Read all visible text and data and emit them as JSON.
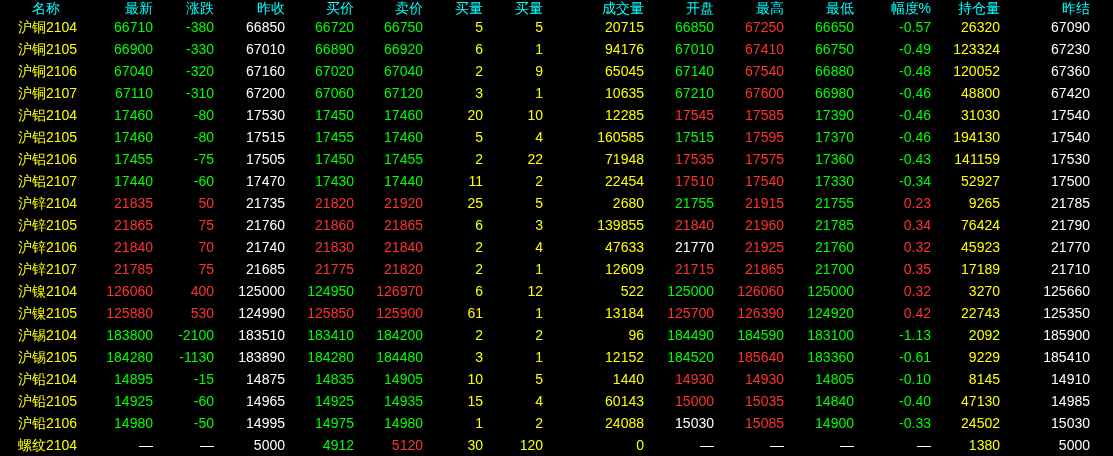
{
  "columns": [
    "名称",
    "最新",
    "涨跌",
    "昨收",
    "买价",
    "卖价",
    "买量",
    "买量",
    "成交量",
    "开盘",
    "最高",
    "最低",
    "幅度%",
    "持仓量",
    "昨结"
  ],
  "rows": [
    {
      "cells": [
        {
          "text": "沪铜2104",
          "color": "#ffff00"
        },
        {
          "text": "66710",
          "color": "#00ff00"
        },
        {
          "text": "-380",
          "color": "#00ff00"
        },
        {
          "text": "66850",
          "color": "#ffffff"
        },
        {
          "text": "66720",
          "color": "#00ff00"
        },
        {
          "text": "66750",
          "color": "#00ff00"
        },
        {
          "text": "5",
          "color": "#ffff00"
        },
        {
          "text": "5",
          "color": "#ffff00"
        },
        {
          "text": "20715",
          "color": "#ffff00"
        },
        {
          "text": "66850",
          "color": "#00ff00"
        },
        {
          "text": "67250",
          "color": "#ff3232"
        },
        {
          "text": "66650",
          "color": "#00ff00"
        },
        {
          "text": "-0.57",
          "color": "#00ff00"
        },
        {
          "text": "26320",
          "color": "#ffff00"
        },
        {
          "text": "67090",
          "color": "#ffffff"
        }
      ]
    },
    {
      "cells": [
        {
          "text": "沪铜2105",
          "color": "#ffff00"
        },
        {
          "text": "66900",
          "color": "#00ff00"
        },
        {
          "text": "-330",
          "color": "#00ff00"
        },
        {
          "text": "67010",
          "color": "#ffffff"
        },
        {
          "text": "66890",
          "color": "#00ff00"
        },
        {
          "text": "66920",
          "color": "#00ff00"
        },
        {
          "text": "6",
          "color": "#ffff00"
        },
        {
          "text": "1",
          "color": "#ffff00"
        },
        {
          "text": "94176",
          "color": "#ffff00"
        },
        {
          "text": "67010",
          "color": "#00ff00"
        },
        {
          "text": "67410",
          "color": "#ff3232"
        },
        {
          "text": "66750",
          "color": "#00ff00"
        },
        {
          "text": "-0.49",
          "color": "#00ff00"
        },
        {
          "text": "123324",
          "color": "#ffff00"
        },
        {
          "text": "67230",
          "color": "#ffffff"
        }
      ]
    },
    {
      "cells": [
        {
          "text": "沪铜2106",
          "color": "#ffff00"
        },
        {
          "text": "67040",
          "color": "#00ff00"
        },
        {
          "text": "-320",
          "color": "#00ff00"
        },
        {
          "text": "67160",
          "color": "#ffffff"
        },
        {
          "text": "67020",
          "color": "#00ff00"
        },
        {
          "text": "67040",
          "color": "#00ff00"
        },
        {
          "text": "2",
          "color": "#ffff00"
        },
        {
          "text": "9",
          "color": "#ffff00"
        },
        {
          "text": "65045",
          "color": "#ffff00"
        },
        {
          "text": "67140",
          "color": "#00ff00"
        },
        {
          "text": "67540",
          "color": "#ff3232"
        },
        {
          "text": "66880",
          "color": "#00ff00"
        },
        {
          "text": "-0.48",
          "color": "#00ff00"
        },
        {
          "text": "120052",
          "color": "#ffff00"
        },
        {
          "text": "67360",
          "color": "#ffffff"
        }
      ]
    },
    {
      "cells": [
        {
          "text": "沪铜2107",
          "color": "#ffff00"
        },
        {
          "text": "67110",
          "color": "#00ff00"
        },
        {
          "text": "-310",
          "color": "#00ff00"
        },
        {
          "text": "67200",
          "color": "#ffffff"
        },
        {
          "text": "67060",
          "color": "#00ff00"
        },
        {
          "text": "67120",
          "color": "#00ff00"
        },
        {
          "text": "3",
          "color": "#ffff00"
        },
        {
          "text": "1",
          "color": "#ffff00"
        },
        {
          "text": "10635",
          "color": "#ffff00"
        },
        {
          "text": "67210",
          "color": "#00ff00"
        },
        {
          "text": "67600",
          "color": "#ff3232"
        },
        {
          "text": "66980",
          "color": "#00ff00"
        },
        {
          "text": "-0.46",
          "color": "#00ff00"
        },
        {
          "text": "48800",
          "color": "#ffff00"
        },
        {
          "text": "67420",
          "color": "#ffffff"
        }
      ]
    },
    {
      "cells": [
        {
          "text": "沪铝2104",
          "color": "#ffff00"
        },
        {
          "text": "17460",
          "color": "#00ff00"
        },
        {
          "text": "-80",
          "color": "#00ff00"
        },
        {
          "text": "17530",
          "color": "#ffffff"
        },
        {
          "text": "17450",
          "color": "#00ff00"
        },
        {
          "text": "17460",
          "color": "#00ff00"
        },
        {
          "text": "20",
          "color": "#ffff00"
        },
        {
          "text": "10",
          "color": "#ffff00"
        },
        {
          "text": "12285",
          "color": "#ffff00"
        },
        {
          "text": "17545",
          "color": "#ff3232"
        },
        {
          "text": "17585",
          "color": "#ff3232"
        },
        {
          "text": "17390",
          "color": "#00ff00"
        },
        {
          "text": "-0.46",
          "color": "#00ff00"
        },
        {
          "text": "31030",
          "color": "#ffff00"
        },
        {
          "text": "17540",
          "color": "#ffffff"
        }
      ]
    },
    {
      "cells": [
        {
          "text": "沪铝2105",
          "color": "#ffff00"
        },
        {
          "text": "17460",
          "color": "#00ff00"
        },
        {
          "text": "-80",
          "color": "#00ff00"
        },
        {
          "text": "17515",
          "color": "#ffffff"
        },
        {
          "text": "17455",
          "color": "#00ff00"
        },
        {
          "text": "17460",
          "color": "#00ff00"
        },
        {
          "text": "5",
          "color": "#ffff00"
        },
        {
          "text": "4",
          "color": "#ffff00"
        },
        {
          "text": "160585",
          "color": "#ffff00"
        },
        {
          "text": "17515",
          "color": "#00ff00"
        },
        {
          "text": "17595",
          "color": "#ff3232"
        },
        {
          "text": "17370",
          "color": "#00ff00"
        },
        {
          "text": "-0.46",
          "color": "#00ff00"
        },
        {
          "text": "194130",
          "color": "#ffff00"
        },
        {
          "text": "17540",
          "color": "#ffffff"
        }
      ]
    },
    {
      "cells": [
        {
          "text": "沪铝2106",
          "color": "#ffff00"
        },
        {
          "text": "17455",
          "color": "#00ff00"
        },
        {
          "text": "-75",
          "color": "#00ff00"
        },
        {
          "text": "17505",
          "color": "#ffffff"
        },
        {
          "text": "17450",
          "color": "#00ff00"
        },
        {
          "text": "17455",
          "color": "#00ff00"
        },
        {
          "text": "2",
          "color": "#ffff00"
        },
        {
          "text": "22",
          "color": "#ffff00"
        },
        {
          "text": "71948",
          "color": "#ffff00"
        },
        {
          "text": "17535",
          "color": "#ff3232"
        },
        {
          "text": "17575",
          "color": "#ff3232"
        },
        {
          "text": "17360",
          "color": "#00ff00"
        },
        {
          "text": "-0.43",
          "color": "#00ff00"
        },
        {
          "text": "141159",
          "color": "#ffff00"
        },
        {
          "text": "17530",
          "color": "#ffffff"
        }
      ]
    },
    {
      "cells": [
        {
          "text": "沪铝2107",
          "color": "#ffff00"
        },
        {
          "text": "17440",
          "color": "#00ff00"
        },
        {
          "text": "-60",
          "color": "#00ff00"
        },
        {
          "text": "17470",
          "color": "#ffffff"
        },
        {
          "text": "17430",
          "color": "#00ff00"
        },
        {
          "text": "17440",
          "color": "#00ff00"
        },
        {
          "text": "11",
          "color": "#ffff00"
        },
        {
          "text": "2",
          "color": "#ffff00"
        },
        {
          "text": "22454",
          "color": "#ffff00"
        },
        {
          "text": "17510",
          "color": "#ff3232"
        },
        {
          "text": "17540",
          "color": "#ff3232"
        },
        {
          "text": "17330",
          "color": "#00ff00"
        },
        {
          "text": "-0.34",
          "color": "#00ff00"
        },
        {
          "text": "52927",
          "color": "#ffff00"
        },
        {
          "text": "17500",
          "color": "#ffffff"
        }
      ]
    },
    {
      "cells": [
        {
          "text": "沪锌2104",
          "color": "#ffff00"
        },
        {
          "text": "21835",
          "color": "#ff3232"
        },
        {
          "text": "50",
          "color": "#ff3232"
        },
        {
          "text": "21735",
          "color": "#ffffff"
        },
        {
          "text": "21820",
          "color": "#ff3232"
        },
        {
          "text": "21920",
          "color": "#ff3232"
        },
        {
          "text": "25",
          "color": "#ffff00"
        },
        {
          "text": "5",
          "color": "#ffff00"
        },
        {
          "text": "2680",
          "color": "#ffff00"
        },
        {
          "text": "21755",
          "color": "#00ff00"
        },
        {
          "text": "21915",
          "color": "#ff3232"
        },
        {
          "text": "21755",
          "color": "#00ff00"
        },
        {
          "text": "0.23",
          "color": "#ff3232"
        },
        {
          "text": "9265",
          "color": "#ffff00"
        },
        {
          "text": "21785",
          "color": "#ffffff"
        }
      ]
    },
    {
      "cells": [
        {
          "text": "沪锌2105",
          "color": "#ffff00"
        },
        {
          "text": "21865",
          "color": "#ff3232"
        },
        {
          "text": "75",
          "color": "#ff3232"
        },
        {
          "text": "21760",
          "color": "#ffffff"
        },
        {
          "text": "21860",
          "color": "#ff3232"
        },
        {
          "text": "21865",
          "color": "#ff3232"
        },
        {
          "text": "6",
          "color": "#ffff00"
        },
        {
          "text": "3",
          "color": "#ffff00"
        },
        {
          "text": "139855",
          "color": "#ffff00"
        },
        {
          "text": "21840",
          "color": "#ff3232"
        },
        {
          "text": "21960",
          "color": "#ff3232"
        },
        {
          "text": "21785",
          "color": "#00ff00"
        },
        {
          "text": "0.34",
          "color": "#ff3232"
        },
        {
          "text": "76424",
          "color": "#ffff00"
        },
        {
          "text": "21790",
          "color": "#ffffff"
        }
      ]
    },
    {
      "cells": [
        {
          "text": "沪锌2106",
          "color": "#ffff00"
        },
        {
          "text": "21840",
          "color": "#ff3232"
        },
        {
          "text": "70",
          "color": "#ff3232"
        },
        {
          "text": "21740",
          "color": "#ffffff"
        },
        {
          "text": "21830",
          "color": "#ff3232"
        },
        {
          "text": "21840",
          "color": "#ff3232"
        },
        {
          "text": "2",
          "color": "#ffff00"
        },
        {
          "text": "4",
          "color": "#ffff00"
        },
        {
          "text": "47633",
          "color": "#ffff00"
        },
        {
          "text": "21770",
          "color": "#ffffff"
        },
        {
          "text": "21925",
          "color": "#ff3232"
        },
        {
          "text": "21760",
          "color": "#00ff00"
        },
        {
          "text": "0.32",
          "color": "#ff3232"
        },
        {
          "text": "45923",
          "color": "#ffff00"
        },
        {
          "text": "21770",
          "color": "#ffffff"
        }
      ]
    },
    {
      "cells": [
        {
          "text": "沪锌2107",
          "color": "#ffff00"
        },
        {
          "text": "21785",
          "color": "#ff3232"
        },
        {
          "text": "75",
          "color": "#ff3232"
        },
        {
          "text": "21685",
          "color": "#ffffff"
        },
        {
          "text": "21775",
          "color": "#ff3232"
        },
        {
          "text": "21820",
          "color": "#ff3232"
        },
        {
          "text": "2",
          "color": "#ffff00"
        },
        {
          "text": "1",
          "color": "#ffff00"
        },
        {
          "text": "12609",
          "color": "#ffff00"
        },
        {
          "text": "21715",
          "color": "#ff3232"
        },
        {
          "text": "21865",
          "color": "#ff3232"
        },
        {
          "text": "21700",
          "color": "#00ff00"
        },
        {
          "text": "0.35",
          "color": "#ff3232"
        },
        {
          "text": "17189",
          "color": "#ffff00"
        },
        {
          "text": "21710",
          "color": "#ffffff"
        }
      ]
    },
    {
      "cells": [
        {
          "text": "沪镍2104",
          "color": "#ffff00"
        },
        {
          "text": "126060",
          "color": "#ff3232"
        },
        {
          "text": "400",
          "color": "#ff3232"
        },
        {
          "text": "125000",
          "color": "#ffffff"
        },
        {
          "text": "124950",
          "color": "#00ff00"
        },
        {
          "text": "126970",
          "color": "#ff3232"
        },
        {
          "text": "6",
          "color": "#ffff00"
        },
        {
          "text": "12",
          "color": "#ffff00"
        },
        {
          "text": "522",
          "color": "#ffff00"
        },
        {
          "text": "125000",
          "color": "#00ff00"
        },
        {
          "text": "126060",
          "color": "#ff3232"
        },
        {
          "text": "125000",
          "color": "#00ff00"
        },
        {
          "text": "0.32",
          "color": "#ff3232"
        },
        {
          "text": "3270",
          "color": "#ffff00"
        },
        {
          "text": "125660",
          "color": "#ffffff"
        }
      ]
    },
    {
      "cells": [
        {
          "text": "沪镍2105",
          "color": "#ffff00"
        },
        {
          "text": "125880",
          "color": "#ff3232"
        },
        {
          "text": "530",
          "color": "#ff3232"
        },
        {
          "text": "124990",
          "color": "#ffffff"
        },
        {
          "text": "125850",
          "color": "#ff3232"
        },
        {
          "text": "125900",
          "color": "#ff3232"
        },
        {
          "text": "61",
          "color": "#ffff00"
        },
        {
          "text": "1",
          "color": "#ffff00"
        },
        {
          "text": "13184",
          "color": "#ffff00"
        },
        {
          "text": "125700",
          "color": "#ff3232"
        },
        {
          "text": "126390",
          "color": "#ff3232"
        },
        {
          "text": "124920",
          "color": "#00ff00"
        },
        {
          "text": "0.42",
          "color": "#ff3232"
        },
        {
          "text": "22743",
          "color": "#ffff00"
        },
        {
          "text": "125350",
          "color": "#ffffff"
        }
      ]
    },
    {
      "cells": [
        {
          "text": "沪锡2104",
          "color": "#ffff00"
        },
        {
          "text": "183800",
          "color": "#00ff00"
        },
        {
          "text": "-2100",
          "color": "#00ff00"
        },
        {
          "text": "183510",
          "color": "#ffffff"
        },
        {
          "text": "183410",
          "color": "#00ff00"
        },
        {
          "text": "184200",
          "color": "#00ff00"
        },
        {
          "text": "2",
          "color": "#ffff00"
        },
        {
          "text": "2",
          "color": "#ffff00"
        },
        {
          "text": "96",
          "color": "#ffff00"
        },
        {
          "text": "184490",
          "color": "#00ff00"
        },
        {
          "text": "184590",
          "color": "#00ff00"
        },
        {
          "text": "183100",
          "color": "#00ff00"
        },
        {
          "text": "-1.13",
          "color": "#00ff00"
        },
        {
          "text": "2092",
          "color": "#ffff00"
        },
        {
          "text": "185900",
          "color": "#ffffff"
        }
      ]
    },
    {
      "cells": [
        {
          "text": "沪锡2105",
          "color": "#ffff00"
        },
        {
          "text": "184280",
          "color": "#00ff00"
        },
        {
          "text": "-1130",
          "color": "#00ff00"
        },
        {
          "text": "183890",
          "color": "#ffffff"
        },
        {
          "text": "184280",
          "color": "#00ff00"
        },
        {
          "text": "184480",
          "color": "#00ff00"
        },
        {
          "text": "3",
          "color": "#ffff00"
        },
        {
          "text": "1",
          "color": "#ffff00"
        },
        {
          "text": "12152",
          "color": "#ffff00"
        },
        {
          "text": "184520",
          "color": "#00ff00"
        },
        {
          "text": "185640",
          "color": "#ff3232"
        },
        {
          "text": "183360",
          "color": "#00ff00"
        },
        {
          "text": "-0.61",
          "color": "#00ff00"
        },
        {
          "text": "9229",
          "color": "#ffff00"
        },
        {
          "text": "185410",
          "color": "#ffffff"
        }
      ]
    },
    {
      "cells": [
        {
          "text": "沪铅2104",
          "color": "#ffff00"
        },
        {
          "text": "14895",
          "color": "#00ff00"
        },
        {
          "text": "-15",
          "color": "#00ff00"
        },
        {
          "text": "14875",
          "color": "#ffffff"
        },
        {
          "text": "14835",
          "color": "#00ff00"
        },
        {
          "text": "14905",
          "color": "#00ff00"
        },
        {
          "text": "10",
          "color": "#ffff00"
        },
        {
          "text": "5",
          "color": "#ffff00"
        },
        {
          "text": "1440",
          "color": "#ffff00"
        },
        {
          "text": "14930",
          "color": "#ff3232"
        },
        {
          "text": "14930",
          "color": "#ff3232"
        },
        {
          "text": "14805",
          "color": "#00ff00"
        },
        {
          "text": "-0.10",
          "color": "#00ff00"
        },
        {
          "text": "8145",
          "color": "#ffff00"
        },
        {
          "text": "14910",
          "color": "#ffffff"
        }
      ]
    },
    {
      "cells": [
        {
          "text": "沪铅2105",
          "color": "#ffff00"
        },
        {
          "text": "14925",
          "color": "#00ff00"
        },
        {
          "text": "-60",
          "color": "#00ff00"
        },
        {
          "text": "14965",
          "color": "#ffffff"
        },
        {
          "text": "14925",
          "color": "#00ff00"
        },
        {
          "text": "14935",
          "color": "#00ff00"
        },
        {
          "text": "15",
          "color": "#ffff00"
        },
        {
          "text": "4",
          "color": "#ffff00"
        },
        {
          "text": "60143",
          "color": "#ffff00"
        },
        {
          "text": "15000",
          "color": "#ff3232"
        },
        {
          "text": "15035",
          "color": "#ff3232"
        },
        {
          "text": "14840",
          "color": "#00ff00"
        },
        {
          "text": "-0.40",
          "color": "#00ff00"
        },
        {
          "text": "47130",
          "color": "#ffff00"
        },
        {
          "text": "14985",
          "color": "#ffffff"
        }
      ]
    },
    {
      "cells": [
        {
          "text": "沪铅2106",
          "color": "#ffff00"
        },
        {
          "text": "14980",
          "color": "#00ff00"
        },
        {
          "text": "-50",
          "color": "#00ff00"
        },
        {
          "text": "14995",
          "color": "#ffffff"
        },
        {
          "text": "14975",
          "color": "#00ff00"
        },
        {
          "text": "14980",
          "color": "#00ff00"
        },
        {
          "text": "1",
          "color": "#ffff00"
        },
        {
          "text": "2",
          "color": "#ffff00"
        },
        {
          "text": "24088",
          "color": "#ffff00"
        },
        {
          "text": "15030",
          "color": "#ffffff"
        },
        {
          "text": "15085",
          "color": "#ff3232"
        },
        {
          "text": "14900",
          "color": "#00ff00"
        },
        {
          "text": "-0.33",
          "color": "#00ff00"
        },
        {
          "text": "24502",
          "color": "#ffff00"
        },
        {
          "text": "15030",
          "color": "#ffffff"
        }
      ]
    },
    {
      "cells": [
        {
          "text": "螺纹2104",
          "color": "#ffff00"
        },
        {
          "text": "—",
          "color": "#ffffff"
        },
        {
          "text": "—",
          "color": "#ffffff"
        },
        {
          "text": "5000",
          "color": "#ffffff"
        },
        {
          "text": "4912",
          "color": "#00ff00"
        },
        {
          "text": "5120",
          "color": "#ff3232"
        },
        {
          "text": "30",
          "color": "#ffff00"
        },
        {
          "text": "120",
          "color": "#ffff00"
        },
        {
          "text": "0",
          "color": "#ffff00"
        },
        {
          "text": "—",
          "color": "#ffffff"
        },
        {
          "text": "—",
          "color": "#ffffff"
        },
        {
          "text": "—",
          "color": "#ffffff"
        },
        {
          "text": "—",
          "color": "#ffffff"
        },
        {
          "text": "1380",
          "color": "#ffff00"
        },
        {
          "text": "5000",
          "color": "#ffffff"
        }
      ]
    }
  ]
}
